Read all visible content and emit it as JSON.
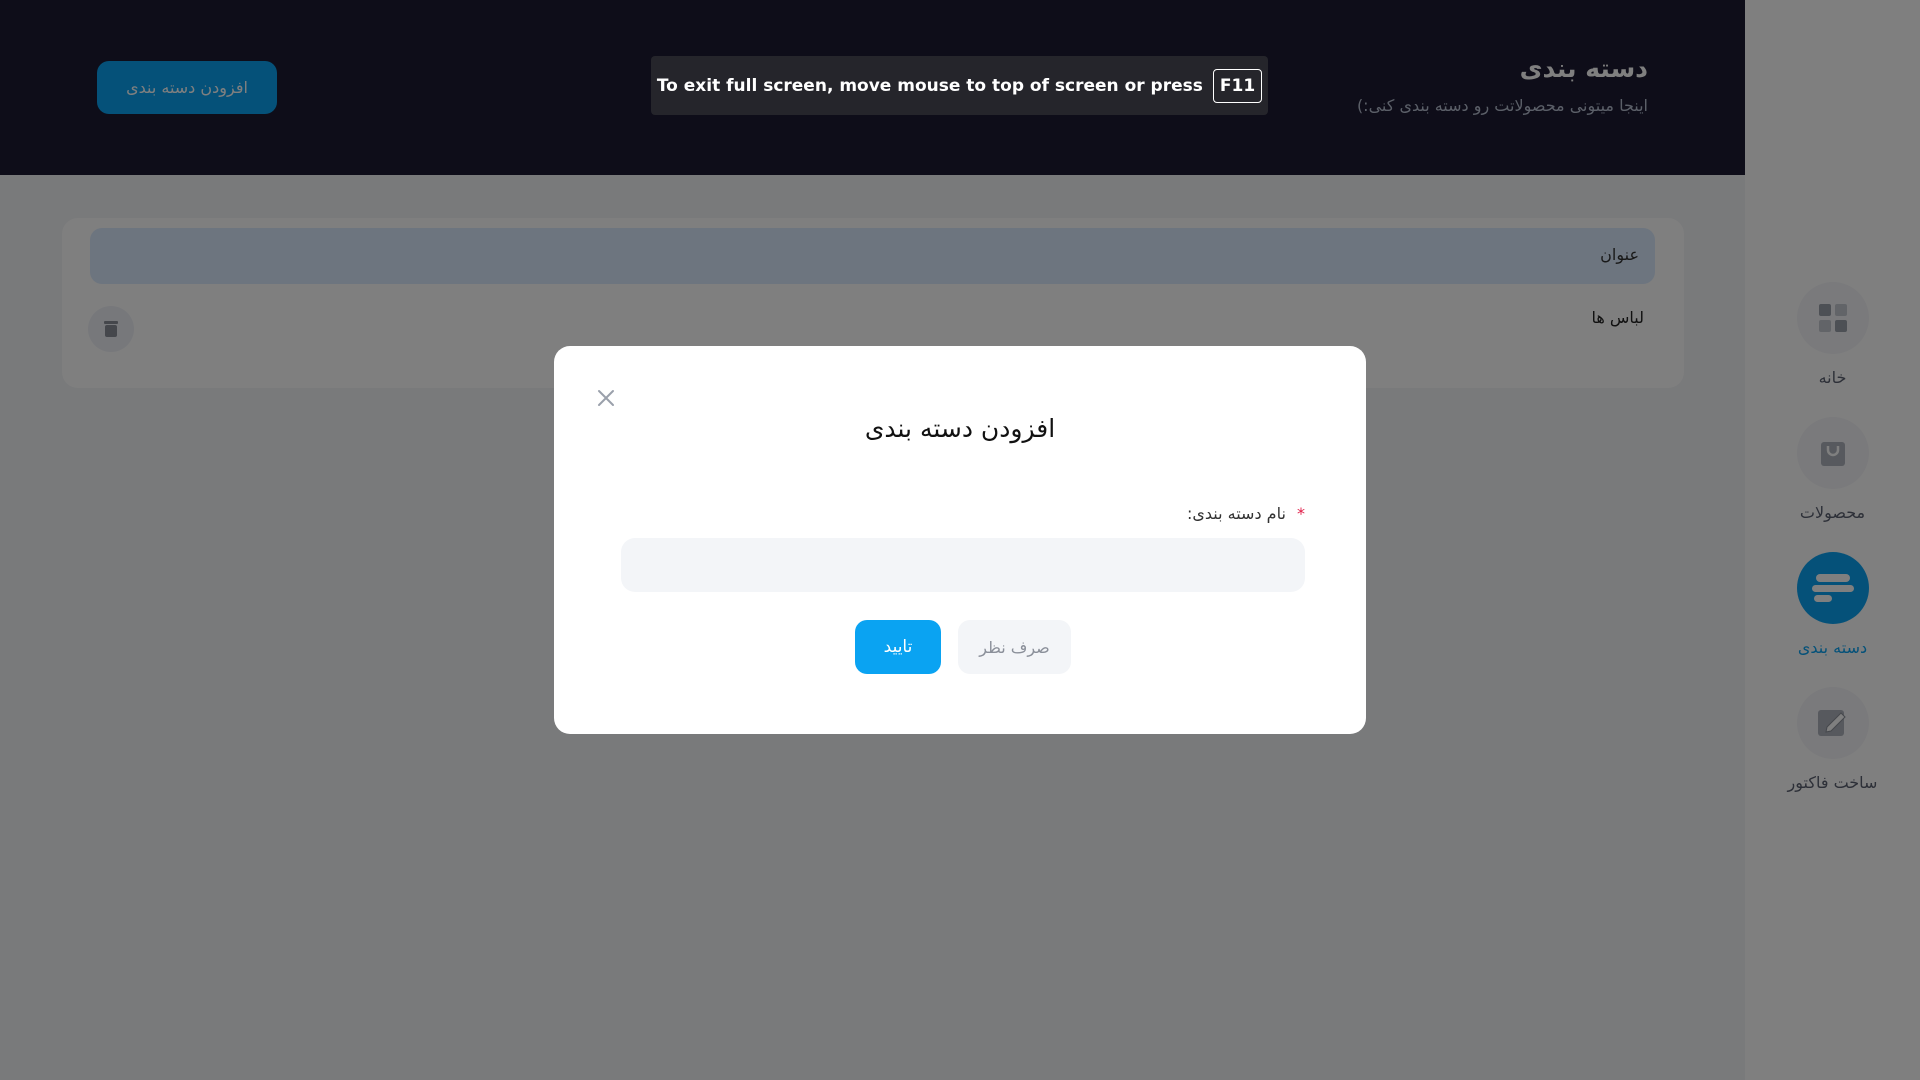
{
  "header": {
    "title": "دسته بندی",
    "subtitle": "اینجا میتونی محصولاتت رو دسته بندی کنی:)",
    "add_button_label": "افزودن دسته بندی"
  },
  "sidebar": {
    "items": [
      {
        "label": "خانه",
        "icon": "grid-icon",
        "active": false
      },
      {
        "label": "محصولات",
        "icon": "shopping-bag-icon",
        "active": false
      },
      {
        "label": "دسته بندی",
        "icon": "category-lines-icon",
        "active": true
      },
      {
        "label": "ساخت فاکتور",
        "icon": "edit-note-icon",
        "active": false
      }
    ]
  },
  "table": {
    "header_title": "عنوان",
    "rows": [
      {
        "name": "لباس ها"
      }
    ]
  },
  "fullscreen_notice": {
    "text": "To exit full screen, move mouse to top of screen or press",
    "key": "F11"
  },
  "modal": {
    "title": "افزودن دسته بندی",
    "field_label": "نام دسته بندی:",
    "required_mark": "*",
    "input_value": "",
    "confirm_label": "تایید",
    "cancel_label": "صرف نظر"
  },
  "colors": {
    "accent": "#0aa3f2",
    "header_bg": "#1c1b33",
    "required": "#e11d48"
  }
}
